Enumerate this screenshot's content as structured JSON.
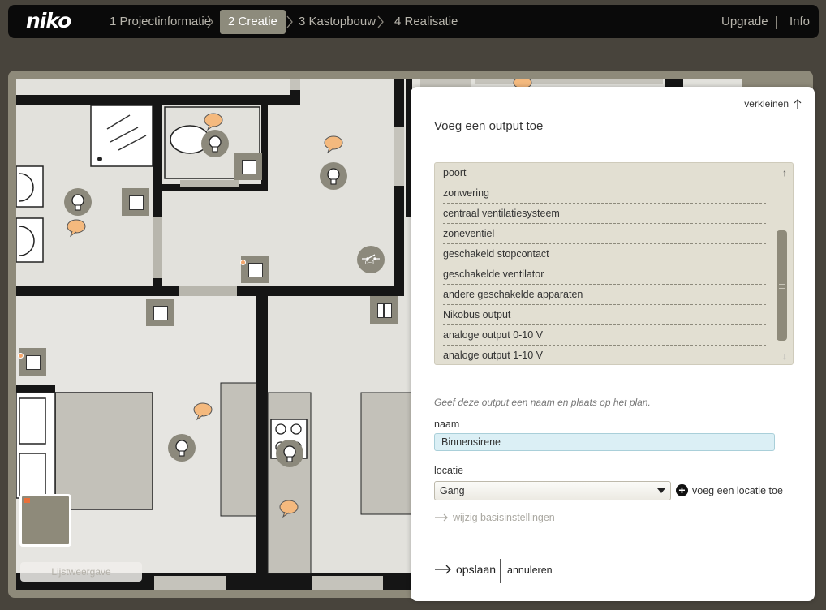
{
  "brand": {
    "logo": "niko"
  },
  "nav": {
    "steps": [
      {
        "label": "1 Projectinformatie"
      },
      {
        "label": "2 Creatie"
      },
      {
        "label": "3 Kastopbouw"
      },
      {
        "label": "4 Realisatie"
      }
    ],
    "upgrade": "Upgrade",
    "info": "Info"
  },
  "plan": {
    "list_view_button": "Lijstweergave",
    "switch_symbol_label": "0~1"
  },
  "panel": {
    "shrink_label": "verkleinen",
    "title": "Voeg een output toe",
    "outputs": [
      "poort",
      "zonwering",
      "centraal ventilatiesysteem",
      "zoneventiel",
      "geschakeld stopcontact",
      "geschakelde ventilator",
      "andere geschakelde apparaten",
      "Nikobus output",
      "analoge output 0-10 V",
      "analoge output 1-10 V"
    ],
    "hint": "Geef deze output een naam en plaats op het plan.",
    "name_label": "naam",
    "name_value": "Binnensirene",
    "location_label": "locatie",
    "location_value": "Gang",
    "add_location": "voeg een locatie toe",
    "basis_settings": "wijzig basisinstellingen",
    "save": "opslaan",
    "cancel": "annuleren"
  },
  "colors": {
    "accent_orange": "#f4b97e",
    "marker_grey": "#8c897c",
    "active_step": "#8d8b7c",
    "input_bg": "#dbeff5"
  }
}
